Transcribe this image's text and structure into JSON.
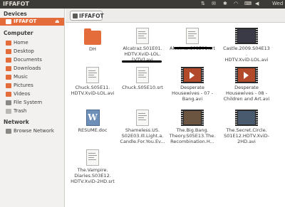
{
  "window": {
    "title": "IFFAFOT",
    "clock": "Wed"
  },
  "sidebar": {
    "devices_heading": "Devices",
    "computer_heading": "Computer",
    "network_heading": "Network",
    "devices": [
      {
        "label": "IFFAFOT",
        "icon": "drive-icon",
        "selected": true
      }
    ],
    "computer": [
      {
        "label": "Home",
        "icon": "home-icon"
      },
      {
        "label": "Desktop",
        "icon": "desktop-icon"
      },
      {
        "label": "Documents",
        "icon": "documents-icon"
      },
      {
        "label": "Downloads",
        "icon": "downloads-icon"
      },
      {
        "label": "Music",
        "icon": "music-icon"
      },
      {
        "label": "Pictures",
        "icon": "pictures-icon"
      },
      {
        "label": "Videos",
        "icon": "videos-icon"
      },
      {
        "label": "File System",
        "icon": "filesystem-icon"
      },
      {
        "label": "Trash",
        "icon": "trash-icon"
      }
    ],
    "network": [
      {
        "label": "Browse Network",
        "icon": "network-icon"
      }
    ]
  },
  "location": {
    "current": "IFFAFOT"
  },
  "files": [
    {
      "name": "DH",
      "type": "folder"
    },
    {
      "name": "Alcatraz.S01E01.\nHDTV.XviD-LOL.\n[VTV].avi",
      "type": "text"
    },
    {
      "name": "Alcatraz.S01E01.srt",
      "type": "text"
    },
    {
      "name": "Castle.2009.S04E13.\nHDTV.XviD-LOL.avi",
      "type": "video"
    },
    {
      "name": "Chuck.S05E11.\nHDTV.XviD-LOL.avi",
      "type": "text"
    },
    {
      "name": "Chuck.S05E10.srt",
      "type": "text"
    },
    {
      "name": "Desperate\nHousewives - 07 -\nBang.avi",
      "type": "video"
    },
    {
      "name": "Desperate\nHousewives - 08 -\nChildren and Art.avi",
      "type": "video"
    },
    {
      "name": "RESUME.doc",
      "type": "word"
    },
    {
      "name": "Shameless.US.\nS02E03.Ill.Light.a.\nCandle.For.You.Ev...",
      "type": "text"
    },
    {
      "name": "The.Big.Bang.\nTheory.S05E13.The.\nRecombination.H...",
      "type": "video"
    },
    {
      "name": "The.Secret.Circle.\nS01E12.HDTV.XviD-\n2HD.avi",
      "type": "video"
    },
    {
      "name": "The.Vampire.\nDiaries.S03E12.\nHDTV.XviD-2HD.srt",
      "type": "text"
    }
  ],
  "colors": {
    "accent": "#e46c3a",
    "panel": "#3c3b37",
    "sidebar_bg": "#f2f1f0"
  }
}
